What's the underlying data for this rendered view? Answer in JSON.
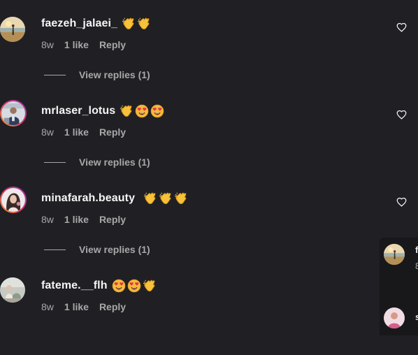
{
  "comments": [
    {
      "username": "faezeh_jalaei_",
      "emojis": [
        "clapping-hands",
        "clapping-hands"
      ],
      "time": "8w",
      "likes": "1 like",
      "reply": "Reply",
      "view_replies": "View replies (1)"
    },
    {
      "username": "mrlaser_lotus",
      "emojis": [
        "clapping-hands",
        "heart-eyes",
        "heart-eyes"
      ],
      "time": "8w",
      "likes": "1 like",
      "reply": "Reply",
      "view_replies": "View replies (1)"
    },
    {
      "username": "minafarah.beauty",
      "emojis": [
        "clapping-hands",
        "clapping-hands",
        "clapping-hands"
      ],
      "time": "8w",
      "likes": "1 like",
      "reply": "Reply",
      "view_replies": "View replies (1)"
    },
    {
      "username": "fateme.__flh",
      "emojis": [
        "heart-eyes",
        "heart-eyes",
        "clapping-hands"
      ],
      "time": "8w",
      "likes": "1 like",
      "reply": "Reply"
    }
  ],
  "side_panel": {
    "item1_initial": "f",
    "item1_time": "8",
    "item2_initial": "s"
  },
  "colors": {
    "background": "#202024",
    "text_primary": "#f5f5f5",
    "text_secondary": "#a8a8a8"
  }
}
